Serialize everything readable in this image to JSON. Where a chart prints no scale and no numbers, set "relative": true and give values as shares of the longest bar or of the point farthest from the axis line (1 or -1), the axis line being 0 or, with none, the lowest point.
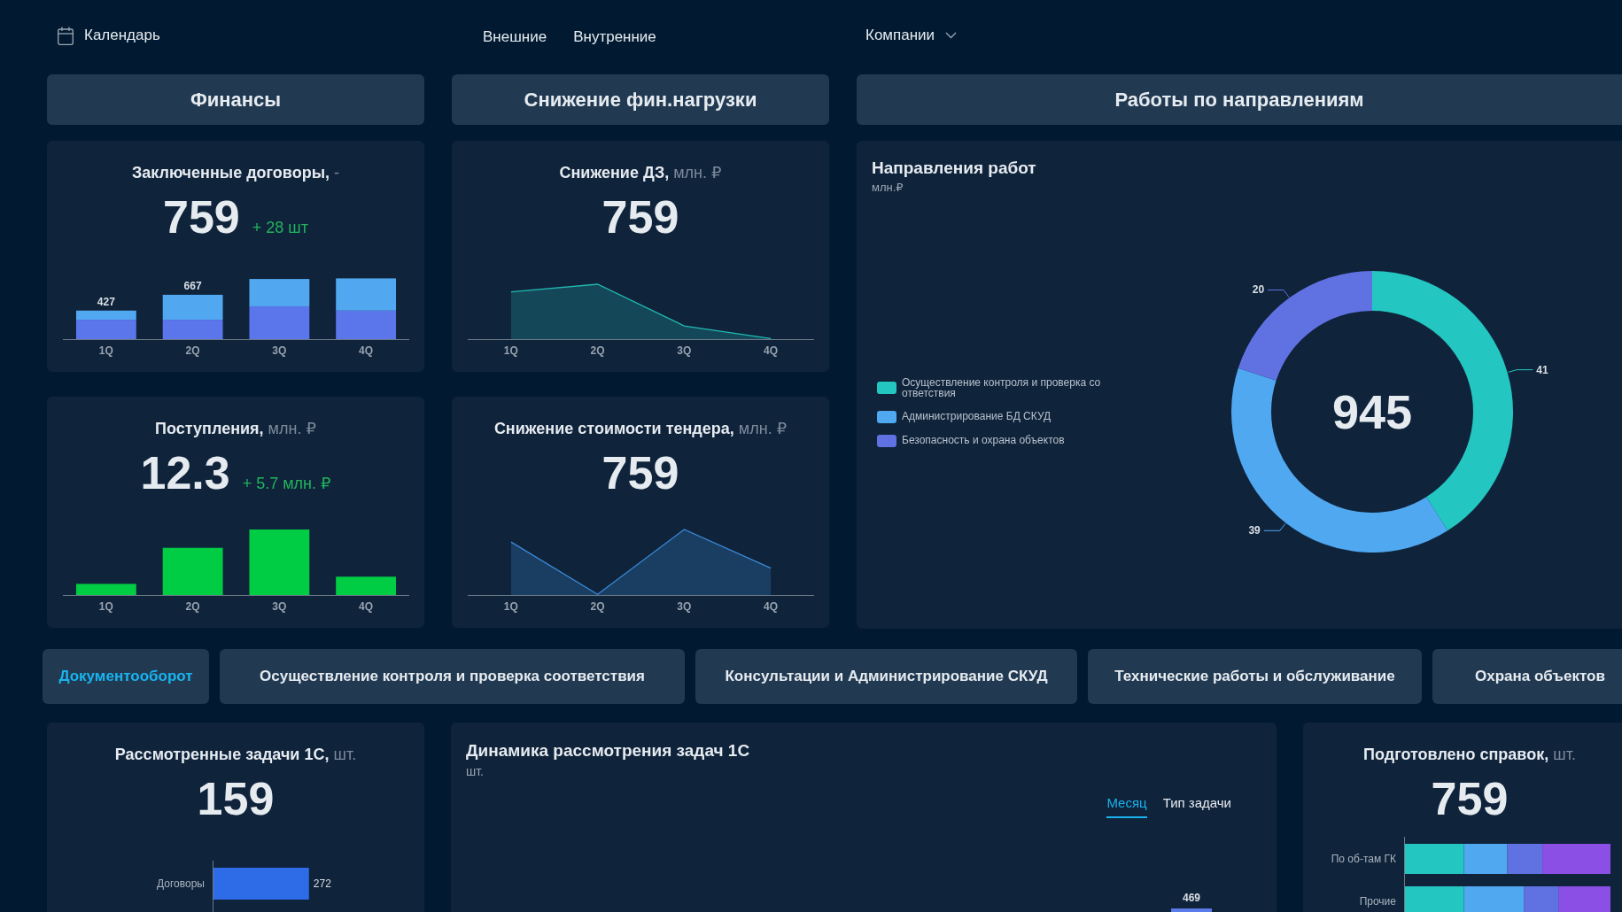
{
  "header": {
    "calendar": {
      "label": "Календарь"
    },
    "filters": [
      {
        "label": "Внешние"
      },
      {
        "label": "Внутренние"
      }
    ],
    "company_filter": {
      "label": "Компании"
    }
  },
  "sections": [
    {
      "title": "Финансы",
      "cards": [
        {
          "kind": "kpi",
          "title": "Заключенные договоры,",
          "unit": "-",
          "value": "759",
          "delta": "+ 28 шт",
          "chart_data": {
            "type": "bar",
            "stacked": true,
            "relative": true,
            "categories": [
              "1Q",
              "2Q",
              "3Q",
              "4Q"
            ],
            "series": [
              {
                "color": "#5a76ea",
                "values": [
                  0.32,
                  0.32,
                  0.54,
                  0.47
                ]
              },
              {
                "color": "#52a8f0",
                "values": [
                  0.15,
                  0.41,
                  0.45,
                  0.53
                ]
              }
            ],
            "annotations": [
              "427",
              "667"
            ]
          }
        },
        {
          "kind": "kpi",
          "title": "Поступления,",
          "unit": "млн. ₽",
          "value": "12.3",
          "delta": "+ 5.7 млн. ₽",
          "chart_data": {
            "type": "bar",
            "relative": true,
            "categories": [
              "1Q",
              "2Q",
              "3Q",
              "4Q"
            ],
            "series": [
              {
                "color": "#00cc44",
                "values": [
                  0.17,
                  0.72,
                  1.0,
                  0.28
                ]
              }
            ]
          }
        }
      ]
    },
    {
      "title": "Снижение фин.нагрузки",
      "cards": [
        {
          "kind": "kpi",
          "title": "Снижение ДЗ,",
          "unit": "млн. ₽",
          "value": "759",
          "chart_data": {
            "type": "area",
            "relative": true,
            "categories": [
              "1Q",
              "2Q",
              "3Q",
              "4Q"
            ],
            "series": [
              {
                "color": "#22b8b0",
                "values": [
                  0.86,
                  1.0,
                  0.24,
                  0.01
                ]
              }
            ]
          }
        },
        {
          "kind": "kpi",
          "title": "Снижение стоимости тендера,",
          "unit": "млн. ₽",
          "value": "759",
          "chart_data": {
            "type": "area",
            "relative": true,
            "categories": [
              "1Q",
              "2Q",
              "3Q",
              "4Q"
            ],
            "series": [
              {
                "color": "#3a8ad8",
                "values": [
                  0.81,
                  0.01,
                  1.0,
                  0.41
                ]
              }
            ]
          }
        }
      ]
    },
    {
      "title": "Работы по направлениям",
      "cards": [
        {
          "kind": "donut",
          "title": "Направления работ",
          "unit": "млн.₽",
          "total": "945",
          "legend": [
            {
              "label": "Осуществление контроля и проверка со ответствия",
              "color": "#24c6c1"
            },
            {
              "label": "Администрирование БД СКУД",
              "color": "#50a8f1"
            },
            {
              "label": "Безопасность и охрана объектов",
              "color": "#6072e2"
            }
          ],
          "chart_data": {
            "type": "donut",
            "values": [
              41,
              39,
              20
            ],
            "data_labels": true
          }
        }
      ]
    }
  ],
  "direction_tabs": [
    {
      "label": "Документооборот",
      "selected": true
    },
    {
      "label": "Осуществление контроля и проверка соответствия",
      "selected": false
    },
    {
      "label": "Консультации и Администрирование СКУД",
      "selected": false
    },
    {
      "label": "Технические работы и обслуживание",
      "selected": false
    },
    {
      "label": "Охрана объектов",
      "selected": false
    }
  ],
  "bottom_cards": [
    {
      "kind": "kpi",
      "title": "Рассмотренные задачи 1С,",
      "unit": "шт.",
      "value": "159",
      "chart_data": {
        "type": "bar",
        "orientation": "horizontal",
        "categories": [
          "Договоры"
        ],
        "values": [
          272
        ],
        "data_labels": true
      }
    },
    {
      "kind": "dynamics",
      "title": "Динамика рассмотрения задач 1С",
      "unit": "шт.",
      "tabs": [
        {
          "label": "Месяц",
          "selected": true
        },
        {
          "label": "Тип задачи",
          "selected": false
        }
      ],
      "bar_labels": [
        "469"
      ]
    },
    {
      "kind": "kpi",
      "title": "Подготовлено справок,",
      "unit": "шт.",
      "value": "759",
      "chart_data": {
        "type": "bar",
        "orientation": "horizontal",
        "stacked": true,
        "relative": true,
        "categories": [
          "По об-там ГК",
          "Прочие"
        ],
        "series": [
          {
            "color": "#24c6c1",
            "values": [
              0.29,
              0.29
            ]
          },
          {
            "color": "#50a8f1",
            "values": [
              0.21,
              0.29
            ]
          },
          {
            "color": "#6072e2",
            "values": [
              0.17,
              0.17
            ]
          },
          {
            "color": "#8c4fe6",
            "values": [
              0.33,
              0.25
            ]
          }
        ]
      }
    }
  ]
}
